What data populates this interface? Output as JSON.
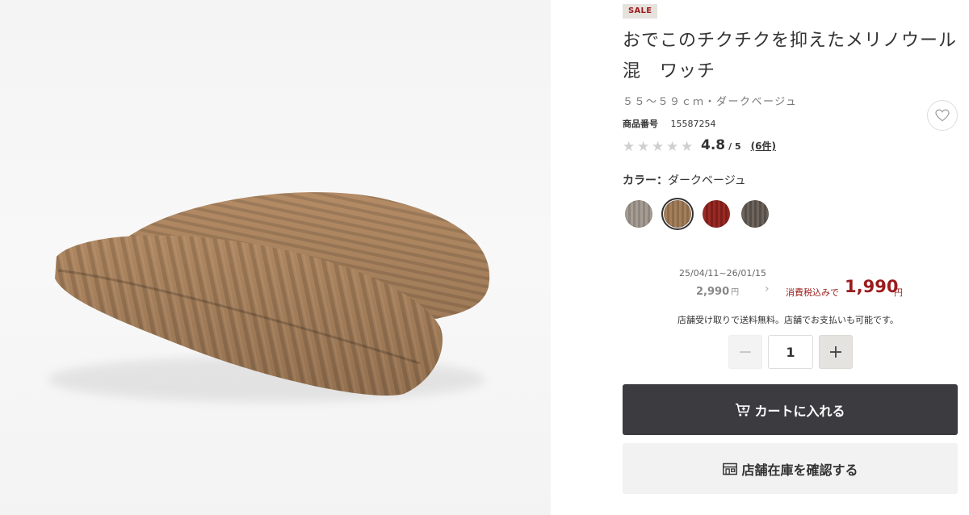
{
  "product": {
    "badge": "SALE",
    "title": "おでこのチクチクを抑えたメリノウール混　ワッチ",
    "variant": "５５〜５９ｃｍ・ダークベージュ",
    "product_no_label": "商品番号",
    "product_no": "15587254",
    "image_alt": "ribbed knit watch cap, dark beige"
  },
  "rating": {
    "stars": [
      "★",
      "★",
      "★",
      "★",
      "★"
    ],
    "value": "4.8",
    "max": "/ 5",
    "reviews": "(6件)"
  },
  "color": {
    "label": "カラー：",
    "selected": "ダークベージュ",
    "swatches": [
      {
        "name": "light-gray-beige",
        "color": "#a69e94"
      },
      {
        "name": "dark-beige",
        "color": "#a07e5c"
      },
      {
        "name": "red",
        "color": "#9a2a24"
      },
      {
        "name": "charcoal-brown",
        "color": "#6e645c"
      }
    ]
  },
  "price": {
    "period": "25/04/11~26/01/15",
    "original": "2,990",
    "yen": "円",
    "arrow": "›",
    "tax_label": "消費税込みで",
    "sale": "1,990",
    "sale_yen": "円"
  },
  "store_note": "店舗受け取りで送料無料。店舗でお支払いも可能です。",
  "quantity": {
    "minus": "−",
    "value": "1",
    "plus": "+"
  },
  "actions": {
    "cart": "カートに入れる",
    "store_stock": "店舗在庫を確認する"
  },
  "colors": {
    "sale_red": "#9b1c1c",
    "cart_bg": "#3c3c40",
    "hat": "#a07e5c"
  }
}
